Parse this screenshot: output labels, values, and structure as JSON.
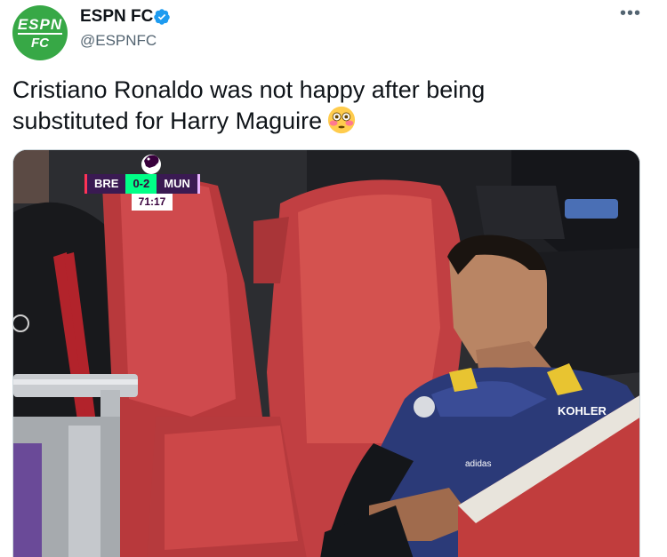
{
  "account": {
    "display_name": "ESPN FC",
    "handle": "@ESPNFC",
    "avatar_line1": "ESPN",
    "avatar_line2": "FC",
    "verified": true
  },
  "menu": {
    "more_label": "•••"
  },
  "tweet": {
    "text": "Cristiano Ronaldo was not happy after being substituted for Harry Maguire",
    "emoji": "flushed-face"
  },
  "scoreboard": {
    "home": "BRE",
    "score": "0-2",
    "away": "MUN",
    "clock": "71:17"
  },
  "colors": {
    "brand_green": "#37a846",
    "verified_blue": "#1d9bf0",
    "score_purple": "#3a1a52",
    "score_green": "#00ff87",
    "seat_red": "#c93b40"
  }
}
